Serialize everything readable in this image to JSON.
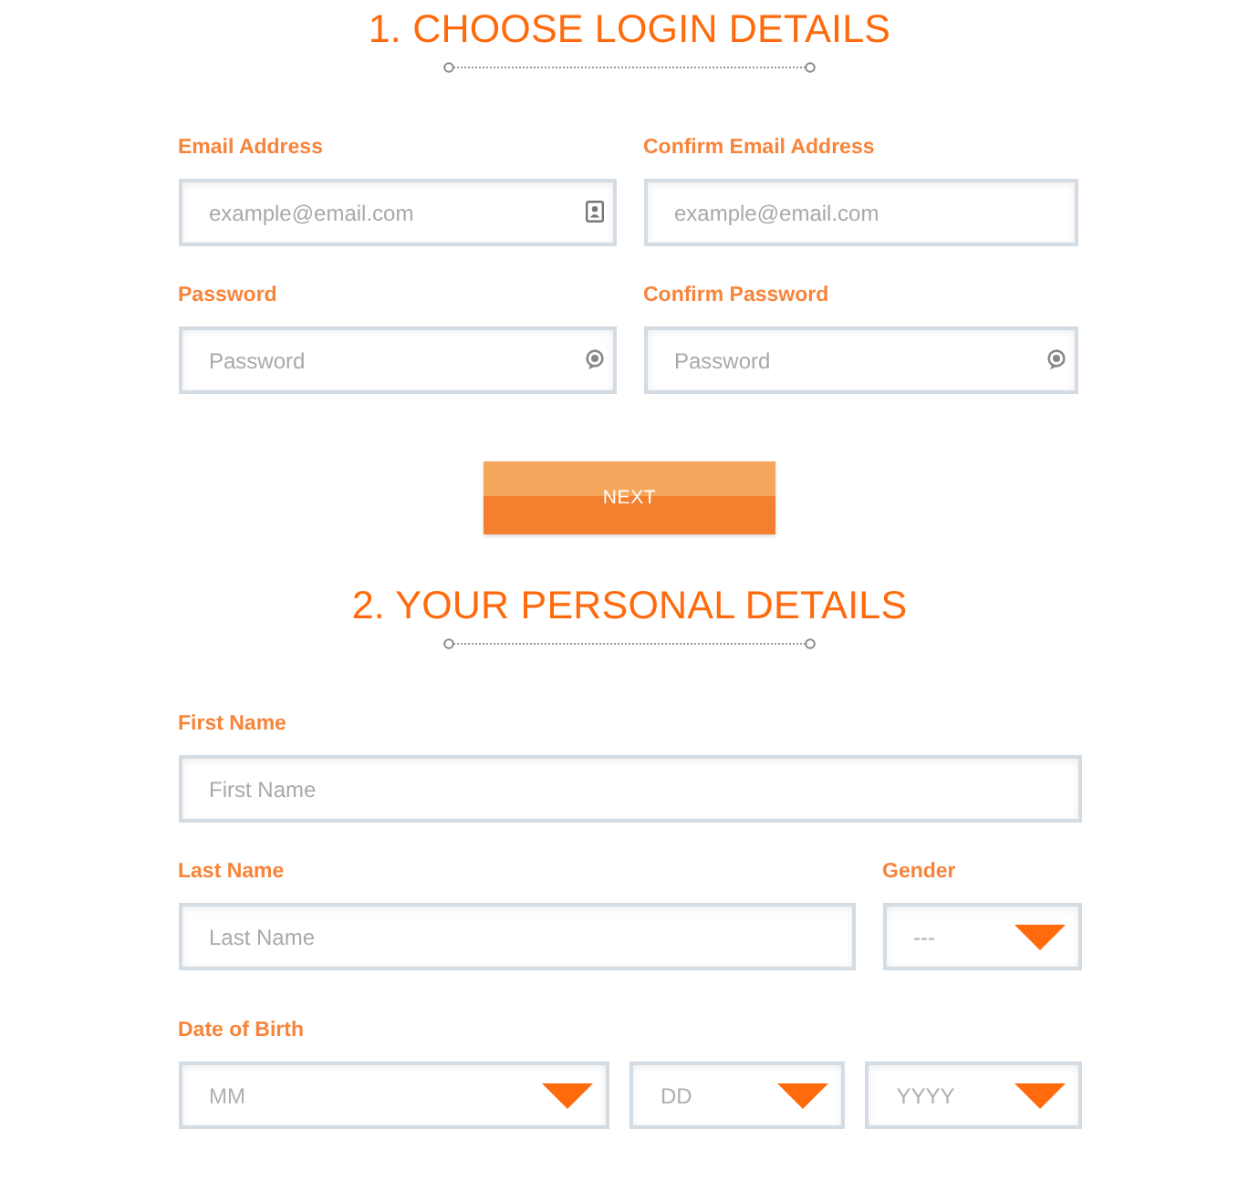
{
  "sections": [
    {
      "title": "1. CHOOSE LOGIN DETAILS",
      "groups": [
        {
          "fields": [
            {
              "kind": "email",
              "label": "Email Address",
              "placeholder": "example@email.com"
            },
            {
              "kind": "text",
              "label": "Confirm Email Address",
              "placeholder": "example@email.com"
            }
          ]
        },
        {
          "fields": [
            {
              "kind": "password",
              "label": "Password",
              "placeholder": "Password"
            },
            {
              "kind": "password",
              "label": "Confirm Password",
              "placeholder": "Password"
            }
          ]
        }
      ],
      "button": "NEXT"
    },
    {
      "title": "2. YOUR PERSONAL DETAILS",
      "groups": [
        {
          "fields": [
            {
              "kind": "text",
              "label": "First Name",
              "placeholder": "First Name"
            }
          ]
        },
        {
          "fields": [
            {
              "kind": "text",
              "label": "Last Name",
              "placeholder": "Last Name"
            },
            {
              "kind": "select",
              "label": "Gender",
              "placeholder": "---"
            }
          ]
        },
        {
          "fields": [
            {
              "kind": "select",
              "label": "Date of Birth",
              "placeholder": "MM"
            },
            {
              "kind": "select",
              "placeholder": "DD"
            },
            {
              "kind": "select",
              "placeholder": "YYYY"
            }
          ]
        }
      ]
    }
  ]
}
